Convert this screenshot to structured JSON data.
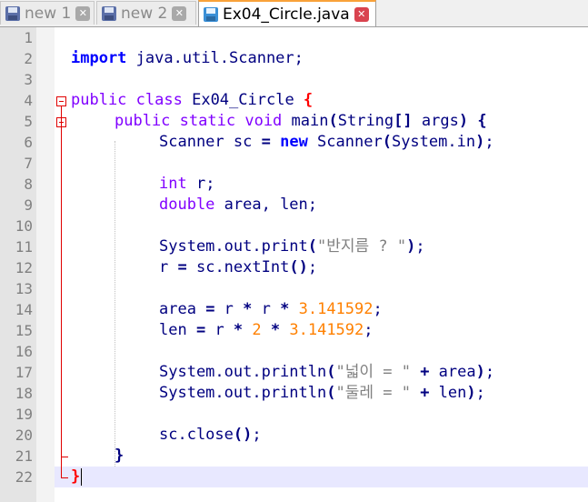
{
  "tabs": [
    {
      "label": "new 1",
      "close": "✕",
      "active": false
    },
    {
      "label": "new 2",
      "close": "✕",
      "active": false
    },
    {
      "label": "Ex04_Circle.java",
      "close": "✕",
      "active": true
    }
  ],
  "line_numbers": [
    "1",
    "2",
    "3",
    "4",
    "5",
    "6",
    "7",
    "8",
    "9",
    "10",
    "11",
    "12",
    "13",
    "14",
    "15",
    "16",
    "17",
    "18",
    "19",
    "20",
    "21",
    "22"
  ],
  "code": {
    "l2": {
      "kw": "import",
      "rest": " java.util.Scanner;"
    },
    "l4": {
      "kw1": "public",
      "kw2": "class",
      "name": " Ex04_Circle ",
      "brace": "{"
    },
    "l5": {
      "kw1": "public",
      "kw2": "static",
      "kw3": "void",
      "rest1": " main",
      "p1": "(",
      "rest2": "String",
      "p2": "[]",
      "rest3": " args",
      "p3": ")",
      "brace": " {"
    },
    "l6": {
      "rest1": "Scanner sc ",
      "eq": "=",
      "kw": "new",
      "rest2": " Scanner",
      "p1": "(",
      "rest3": "System.in",
      "p2": ")",
      "semi": ";"
    },
    "l8": {
      "kw": "int",
      "rest": " r;"
    },
    "l9": {
      "kw": "double",
      "rest": " area, len;"
    },
    "l11": {
      "rest1": "System.out.print",
      "p1": "(",
      "str": "\"반지름 ? \"",
      "p2": ")",
      "semi": ";"
    },
    "l12": {
      "rest1": "r ",
      "eq": "=",
      "rest2": " sc.nextInt",
      "p": "()",
      "semi": ";"
    },
    "l14": {
      "rest1": "area ",
      "eq": "=",
      "rest2": " r ",
      "m1": "*",
      "rest3": " r ",
      "m2": "*",
      "num": " 3.141592",
      "semi": ";"
    },
    "l15": {
      "rest1": "len ",
      "eq": "=",
      "rest2": " r ",
      "m1": "*",
      "num1": " 2",
      "m2": " *",
      "num2": " 3.141592",
      "semi": ";"
    },
    "l17": {
      "rest1": "System.out.println",
      "p1": "(",
      "str": "\"넓이 = \"",
      "plus": " +",
      "rest2": " area",
      "p2": ")",
      "semi": ";"
    },
    "l18": {
      "rest1": "System.out.println",
      "p1": "(",
      "str": "\"둘레 = \"",
      "plus": " +",
      "rest2": " len",
      "p2": ")",
      "semi": ";"
    },
    "l20": {
      "rest1": "sc.close",
      "p": "()",
      "semi": ";"
    },
    "l21": {
      "brace": "}"
    },
    "l22": {
      "brace": "}"
    }
  },
  "colors": {
    "keyword": "#0000ff",
    "type_keyword": "#8000ff",
    "number": "#ff8000",
    "string": "#808080",
    "fold_marker": "#e00000",
    "current_line": "#e8e8ff"
  }
}
